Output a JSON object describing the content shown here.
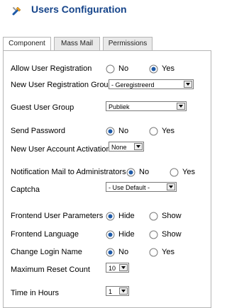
{
  "header": {
    "title": "Users Configuration",
    "icon": "tools-icon"
  },
  "tabs": [
    {
      "label": "Component",
      "active": true
    },
    {
      "label": "Mass Mail",
      "active": false
    },
    {
      "label": "Permissions",
      "active": false
    }
  ],
  "fields": {
    "allow_registration": {
      "label": "Allow User Registration",
      "no": "No",
      "yes": "Yes",
      "selected": "yes"
    },
    "registration_group": {
      "label": "New User Registration Group",
      "value": "- Geregistreerd"
    },
    "guest_group": {
      "label": "Guest User Group",
      "value": "Publiek"
    },
    "send_password": {
      "label": "Send Password",
      "no": "No",
      "yes": "Yes",
      "selected": "no"
    },
    "account_activation": {
      "label": "New User Account Activation",
      "value": "None"
    },
    "notification_mail": {
      "label": "Notification Mail to Administrators",
      "no": "No",
      "yes": "Yes",
      "selected": "no"
    },
    "captcha": {
      "label": "Captcha",
      "value": "- Use Default -"
    },
    "frontend_params": {
      "label": "Frontend User Parameters",
      "hide": "Hide",
      "show": "Show",
      "selected": "hide"
    },
    "frontend_language": {
      "label": "Frontend Language",
      "hide": "Hide",
      "show": "Show",
      "selected": "hide"
    },
    "change_login": {
      "label": "Change Login Name",
      "no": "No",
      "yes": "Yes",
      "selected": "no"
    },
    "max_reset": {
      "label": "Maximum Reset Count",
      "value": "10"
    },
    "time_hours": {
      "label": "Time in Hours",
      "value": "1"
    }
  },
  "colors": {
    "title": "#15448a",
    "radio_selected": "#1e5aa8",
    "border": "#b5b5b5"
  }
}
